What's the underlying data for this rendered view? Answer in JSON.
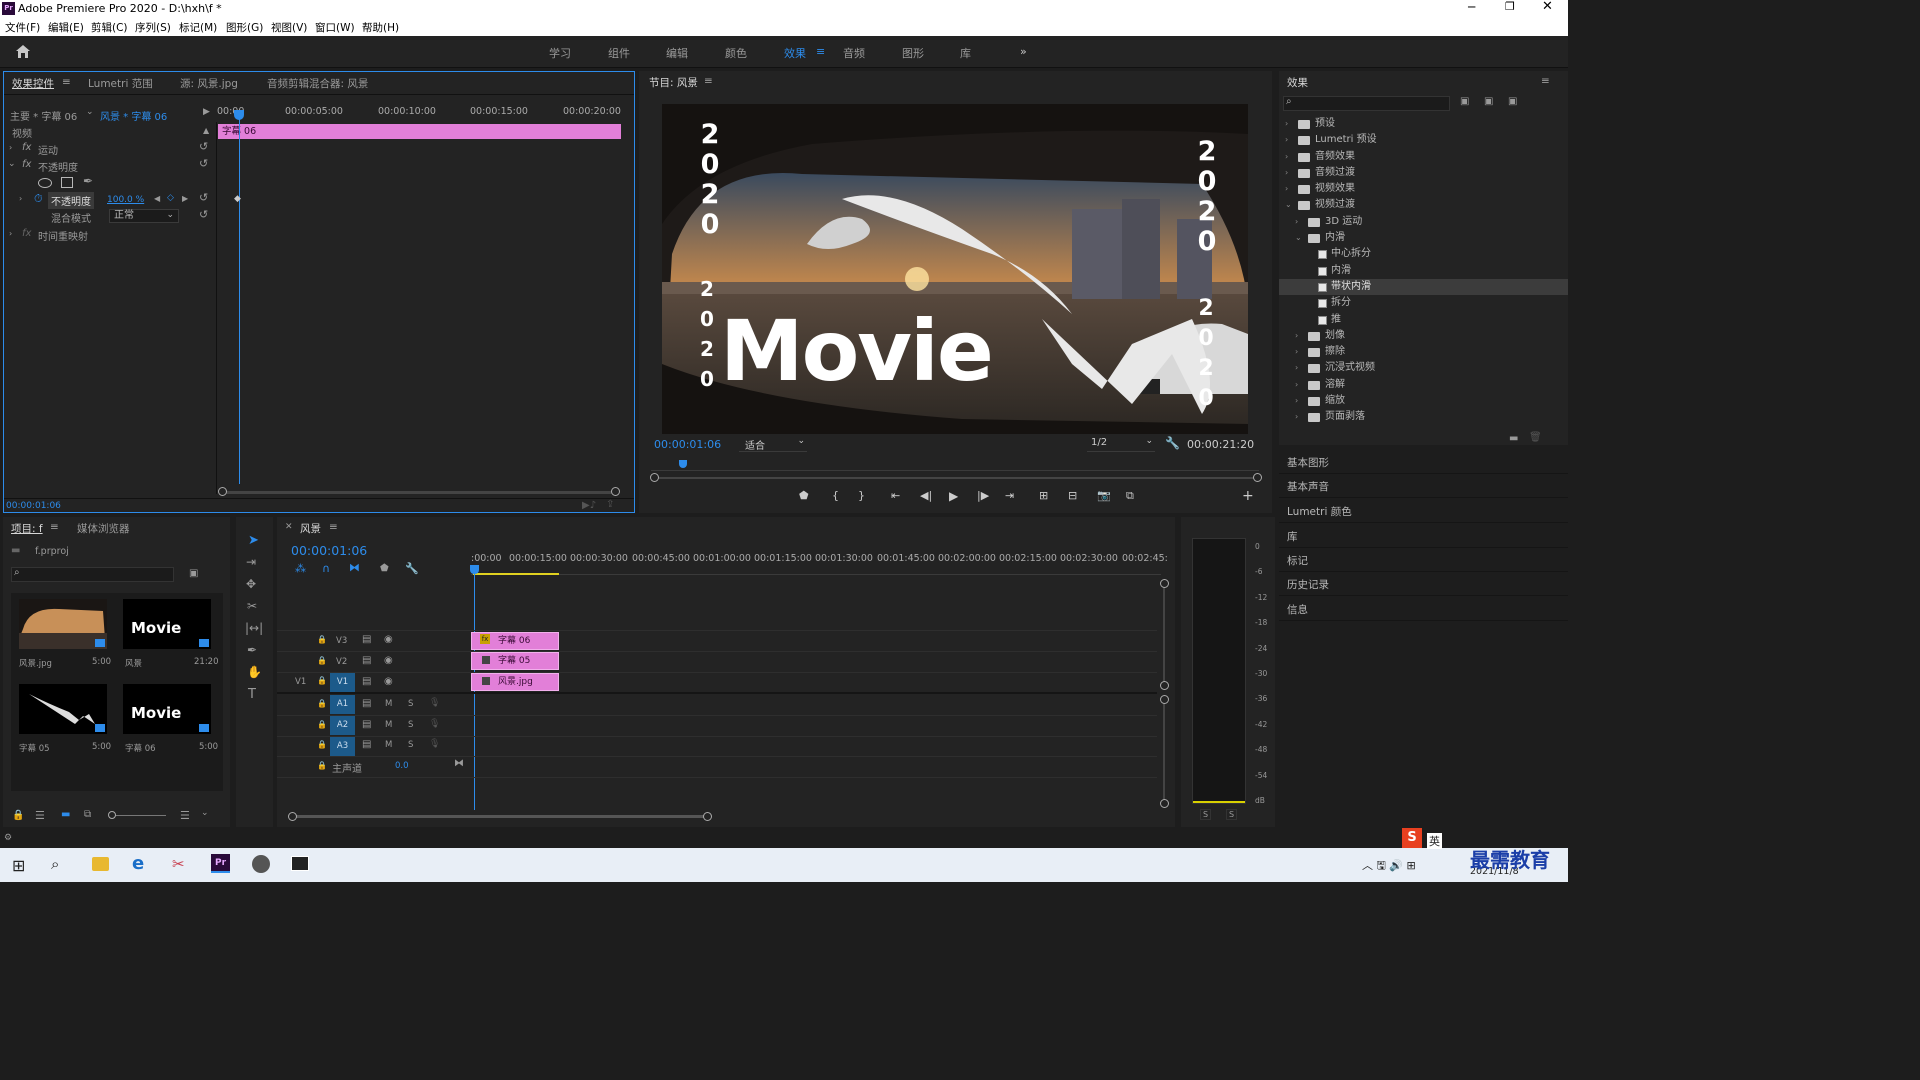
{
  "window": {
    "title": "Adobe Premiere Pro 2020 - D:\\hxh\\f *",
    "app_icon": "Pr"
  },
  "menu": [
    "文件(F)",
    "编辑(E)",
    "剪辑(C)",
    "序列(S)",
    "标记(M)",
    "图形(G)",
    "视图(V)",
    "窗口(W)",
    "帮助(H)"
  ],
  "workspaces": [
    "学习",
    "组件",
    "编辑",
    "颜色",
    "效果",
    "音频",
    "图形",
    "库"
  ],
  "active_workspace": "效果",
  "effect_controls": {
    "tabs": [
      "效果控件",
      "Lumetri 范围",
      "源: 风景.jpg",
      "音频剪辑混合器: 风景"
    ],
    "master": "主要 * 字幕 06",
    "clip": "风景 * 字幕 06",
    "ruler": [
      "00:00",
      "00:00:05:00",
      "00:00:10:00",
      "00:00:15:00",
      "00:00:20:00"
    ],
    "clip_bar": "字幕 06",
    "section": "视频",
    "motion": "运动",
    "opacity": "不透明度",
    "opacity_param": "不透明度",
    "opacity_value": "100.0 %",
    "blend_label": "混合模式",
    "blend_value": "正常",
    "time_remap": "时间重映射",
    "timecode": "00:00:01:06"
  },
  "program": {
    "title": "节目: 风景",
    "timecode": "00:00:01:06",
    "fit": "适合",
    "quality": "1/2",
    "duration": "00:00:21:20",
    "overlay_movie": "Movie",
    "year_left": "2020",
    "year_left2": "2020",
    "year_right": "2020",
    "year_right2": "2020"
  },
  "effects_panel": {
    "title": "效果",
    "items": [
      {
        "label": "预设",
        "level": 0,
        "type": "folder",
        "open": false
      },
      {
        "label": "Lumetri 预设",
        "level": 0,
        "type": "folder",
        "open": false
      },
      {
        "label": "音频效果",
        "level": 0,
        "type": "folder",
        "open": false
      },
      {
        "label": "音频过渡",
        "level": 0,
        "type": "folder",
        "open": false
      },
      {
        "label": "视频效果",
        "level": 0,
        "type": "folder",
        "open": false
      },
      {
        "label": "视频过渡",
        "level": 0,
        "type": "folder",
        "open": true
      },
      {
        "label": "3D 运动",
        "level": 1,
        "type": "folder",
        "open": false
      },
      {
        "label": "内滑",
        "level": 1,
        "type": "folder",
        "open": true
      },
      {
        "label": "中心拆分",
        "level": 2,
        "type": "effect"
      },
      {
        "label": "内滑",
        "level": 2,
        "type": "effect"
      },
      {
        "label": "带状内滑",
        "level": 2,
        "type": "effect",
        "selected": true
      },
      {
        "label": "拆分",
        "level": 2,
        "type": "effect"
      },
      {
        "label": "推",
        "level": 2,
        "type": "effect"
      },
      {
        "label": "划像",
        "level": 1,
        "type": "folder",
        "open": false
      },
      {
        "label": "擦除",
        "level": 1,
        "type": "folder",
        "open": false
      },
      {
        "label": "沉浸式视频",
        "level": 1,
        "type": "folder",
        "open": false
      },
      {
        "label": "溶解",
        "level": 1,
        "type": "folder",
        "open": false
      },
      {
        "label": "缩放",
        "level": 1,
        "type": "folder",
        "open": false
      },
      {
        "label": "页面剥落",
        "level": 1,
        "type": "folder",
        "open": false
      }
    ],
    "collapsed_panels": [
      "基本图形",
      "基本声音",
      "Lumetri 颜色",
      "库",
      "标记",
      "历史记录",
      "信息"
    ]
  },
  "project": {
    "tabs": [
      "项目: f",
      "媒体浏览器"
    ],
    "file": "f.prproj",
    "items": [
      {
        "name": "风景.jpg",
        "dur": "5:00"
      },
      {
        "name": "风景",
        "dur": "21:20"
      },
      {
        "name": "字幕 05",
        "dur": "5:00"
      },
      {
        "name": "字幕 06",
        "dur": "5:00"
      }
    ],
    "thumb_movie": "Movie"
  },
  "timeline": {
    "tab": "风景",
    "timecode": "00:00:01:06",
    "ruler": [
      ":00:00",
      "00:00:15:00",
      "00:00:30:00",
      "00:00:45:00",
      "00:01:00:00",
      "00:01:15:00",
      "00:01:30:00",
      "00:01:45:00",
      "00:02:00:00",
      "00:02:15:00",
      "00:02:30:00",
      "00:02:45:"
    ],
    "video_tracks": [
      "V3",
      "V2",
      "V1"
    ],
    "audio_tracks": [
      "A1",
      "A2",
      "A3"
    ],
    "src_v": "V1",
    "master": "主声道",
    "master_val": "0.0",
    "m": "M",
    "s": "S",
    "clips": [
      "字幕 06",
      "字幕 05",
      "风景.jpg"
    ]
  },
  "meter": {
    "scale": [
      "0",
      "-6",
      "-12",
      "-18",
      "-24",
      "-30",
      "-36",
      "-42",
      "-48",
      "-54",
      "dB"
    ],
    "s": "S"
  },
  "taskbar": {
    "date": "2021/11/8",
    "ime": "英",
    "watermark": "最需教育"
  }
}
